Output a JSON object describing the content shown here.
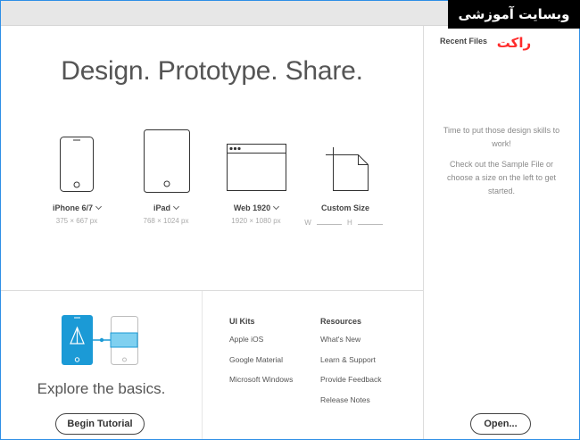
{
  "brand": {
    "text_main": "وبسایت آموزشی ",
    "text_accent": "راکت"
  },
  "headline": "Design. Prototype. Share.",
  "devices": [
    {
      "label": "iPhone 6/7",
      "dims": "375 × 667 px"
    },
    {
      "label": "iPad",
      "dims": "768 × 1024 px"
    },
    {
      "label": "Web 1920",
      "dims": "1920 × 1080 px"
    },
    {
      "label": "Custom Size",
      "w_label": "W",
      "h_label": "H"
    }
  ],
  "recent": {
    "title": "Recent Files",
    "empty_line1": "Time to put those design skills to work!",
    "empty_line2": "Check out the Sample File or choose a size on the left to get started."
  },
  "open_label": "Open...",
  "explore": {
    "text": "Explore the basics.",
    "button": "Begin Tutorial"
  },
  "ui_kits": {
    "heading": "UI Kits",
    "items": [
      "Apple iOS",
      "Google Material",
      "Microsoft Windows"
    ]
  },
  "resources": {
    "heading": "Resources",
    "items": [
      "What's New",
      "Learn & Support",
      "Provide Feedback",
      "Release Notes"
    ]
  },
  "colors": {
    "illustration_blue": "#1b9ad6",
    "illustration_light": "#7fd0f0",
    "frame_border": "#2f8fe6",
    "brand_accent": "#ff2b2b"
  }
}
